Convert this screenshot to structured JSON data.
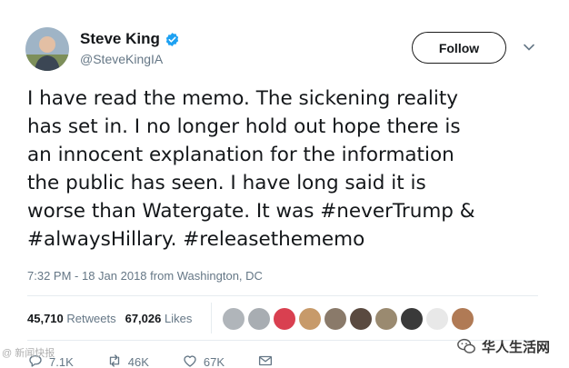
{
  "user": {
    "name": "Steve King",
    "handle": "@SteveKingIA"
  },
  "header": {
    "follow_label": "Follow"
  },
  "tweet": {
    "lines": [
      "I have read the memo. The sickening reality",
      "has set in. I no longer hold out hope there is",
      "an innocent explanation for the information",
      "the public has seen. I have long said it is",
      "worse than Watergate. It was #neverTrump &",
      "#alwaysHillary. #releasethememo"
    ],
    "timestamp": "7:32 PM - 18 Jan 2018 from Washington, DC"
  },
  "stats": {
    "retweets_count": "45,710",
    "retweets_label": "Retweets",
    "likes_count": "67,026",
    "likes_label": "Likes"
  },
  "actions": {
    "reply_count": "7.1K",
    "retweet_count": "46K",
    "like_count": "67K"
  },
  "likers": [
    "#b0b5ba",
    "#a8adb2",
    "#d94050",
    "#c79a6a",
    "#8a7a6a",
    "#5a4a40",
    "#9a8a70",
    "#3a3a3a",
    "#e8e8e8",
    "#b07a55"
  ],
  "watermark": {
    "left_text": "@ 新闻快报",
    "right_text": "华人生活网"
  },
  "colors": {
    "accent": "#1da1f2",
    "muted": "#657786",
    "text": "#14171a"
  }
}
